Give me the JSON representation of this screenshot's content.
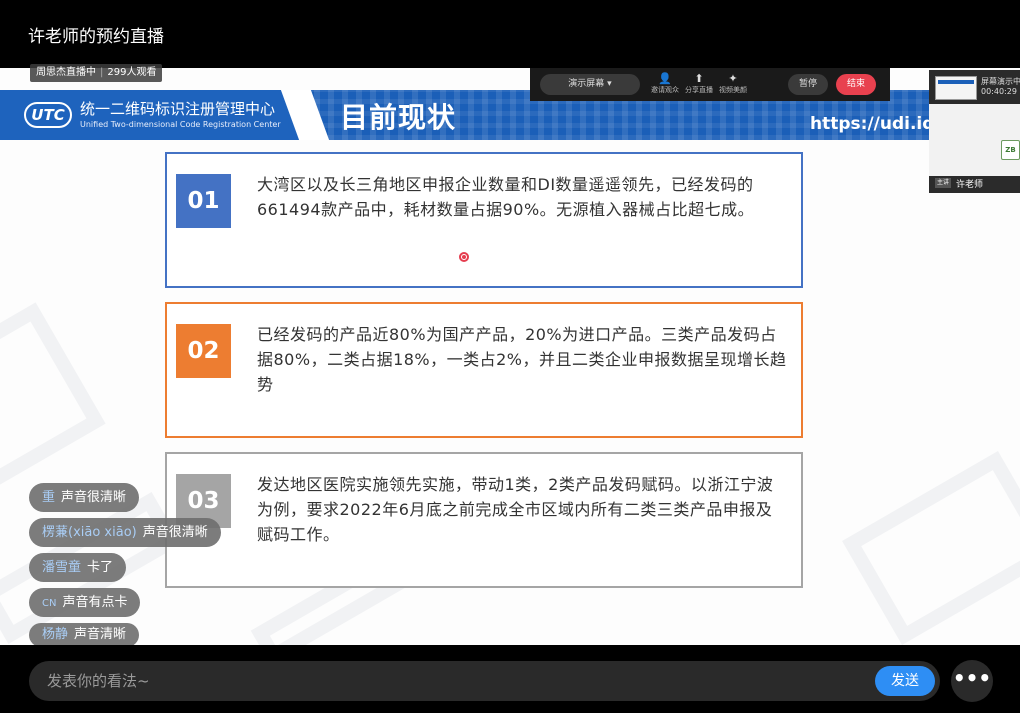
{
  "window": {
    "title": "许老师的预约直播"
  },
  "live_badge": {
    "status": "周思杰直播中",
    "viewers": "299人观看"
  },
  "slide": {
    "logo_mark": "UTC",
    "org_cn": "统一二维码标识注册管理中心",
    "org_en": "Unified Two-dimensional Code Registration Center",
    "title": "目前现状",
    "url": "https://udi.idc",
    "cards": [
      {
        "num": "01",
        "color": "#4472c4",
        "text": "大湾区以及长三角地区申报企业数量和DI数量遥遥领先，已经发码的661494款产品中，耗材数量占据90%。无源植入器械占比超七成。"
      },
      {
        "num": "02",
        "color": "#ed7d31",
        "text": "已经发码的产品近80%为国产产品，20%为进口产品。三类产品发码占据80%，二类占据18%，一类占2%，并且二类企业申报数据呈现增长趋势"
      },
      {
        "num": "03",
        "color": "#a5a5a5",
        "text": "发达地区医院实施领先实施，带动1类，2类产品发码赋码。以浙江宁波为例，要求2022年6月底之前完成全市区域内所有二类三类产品申报及赋码工作。"
      }
    ]
  },
  "share_bar": {
    "screen_select": "演示屏幕 ▾",
    "tools": [
      {
        "icon": "person-icon",
        "glyph": "👤",
        "label": "邀请观众"
      },
      {
        "icon": "share-icon",
        "glyph": "⬆",
        "label": "分享直播"
      },
      {
        "icon": "effects-icon",
        "glyph": "✦",
        "label": "视频美颜"
      }
    ],
    "pause": "暂停",
    "end": "结束"
  },
  "pip": {
    "screen_label": "屏幕演示中",
    "timer": "00:40:29",
    "cam_logo": "ZB",
    "tag": "主讲",
    "presenter": "许老师"
  },
  "danmu": [
    {
      "user": "重",
      "msg": "声音很清晰"
    },
    {
      "user": "楞蒹(xiāo xiāo)",
      "msg": "声音很清晰"
    },
    {
      "user": "潘雪童",
      "msg": "卡了"
    },
    {
      "user": "CN",
      "msg": "声音有点卡"
    },
    {
      "user": "杨静",
      "msg": "声音清晰"
    }
  ],
  "comment": {
    "placeholder": "发表你的看法~",
    "send": "发送",
    "more": "•••"
  }
}
